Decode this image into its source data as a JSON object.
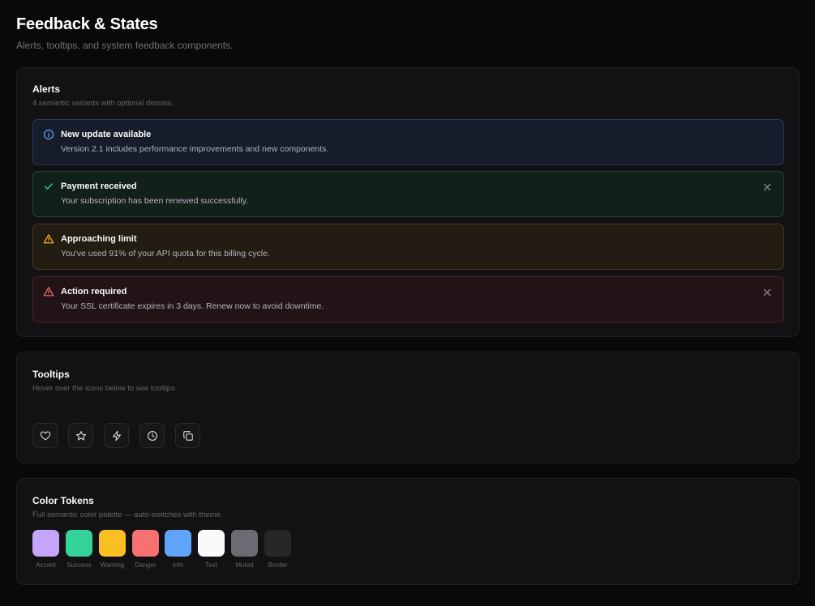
{
  "page": {
    "title": "Feedback & States",
    "subtitle": "Alerts, tooltips, and system feedback components."
  },
  "alerts_section": {
    "title": "Alerts",
    "description": "4 semantic variants with optional dismiss.",
    "items": [
      {
        "variant": "info",
        "icon": "info-icon",
        "title": "New update available",
        "body": "Version 2.1 includes performance improvements and new components.",
        "dismissible": false,
        "color": "#60a5fa"
      },
      {
        "variant": "success",
        "icon": "check-icon",
        "title": "Payment received",
        "body": "Your subscription has been renewed successfully.",
        "dismissible": true,
        "color": "#34d399"
      },
      {
        "variant": "warning",
        "icon": "warning-icon",
        "title": "Approaching limit",
        "body": "You've used 91% of your API quota for this billing cycle.",
        "dismissible": false,
        "color": "#fbbf24"
      },
      {
        "variant": "danger",
        "icon": "alert-triangle-icon",
        "title": "Action required",
        "body": "Your SSL certificate expires in 3 days. Renew now to avoid downtime.",
        "dismissible": true,
        "color": "#f87171"
      }
    ]
  },
  "tooltips_section": {
    "title": "Tooltips",
    "description": "Hover over the icons below to see tooltips.",
    "icons": [
      "heart-icon",
      "star-icon",
      "lightning-icon",
      "clock-icon",
      "copy-icon"
    ]
  },
  "colors_section": {
    "title": "Color Tokens",
    "description": "Full semantic color palette — auto-switches with theme.",
    "tokens": [
      {
        "label": "Accent",
        "color": "#c4a5fb"
      },
      {
        "label": "Success",
        "color": "#34d399"
      },
      {
        "label": "Warning",
        "color": "#fbbf24"
      },
      {
        "label": "Danger",
        "color": "#f87171"
      },
      {
        "label": "Info",
        "color": "#60a5fa"
      },
      {
        "label": "Text",
        "color": "#fafafa"
      },
      {
        "label": "Muted",
        "color": "#6b6b73"
      },
      {
        "label": "Border",
        "color": "#27272a"
      }
    ]
  }
}
